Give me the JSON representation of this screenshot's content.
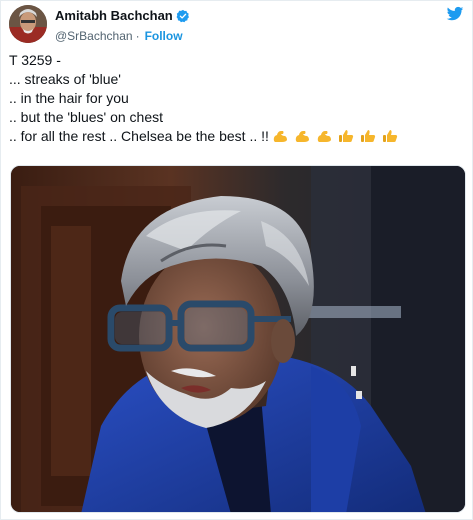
{
  "author": {
    "display_name": "Amitabh Bachchan",
    "handle": "@SrBachchan",
    "separator": "·",
    "follow_label": "Follow",
    "verified_icon": "verified-badge-icon",
    "platform_icon": "twitter-bird-icon"
  },
  "tweet": {
    "lines": [
      "T 3259 -",
      "... streaks of 'blue'",
      ".. in the hair for you",
      ".. but the 'blues' on chest",
      ".. for all the rest .. Chelsea be the best .. !!"
    ],
    "emojis": [
      "flexed-biceps-icon",
      "flexed-biceps-icon",
      "flexed-biceps-icon",
      "thumbs-up-icon",
      "thumbs-up-icon",
      "thumbs-up-icon"
    ]
  },
  "colors": {
    "link": "#1b95e0",
    "verified": "#1d9bf0",
    "jacket": "#1e3fa8",
    "emoji": "#f6b62c"
  }
}
